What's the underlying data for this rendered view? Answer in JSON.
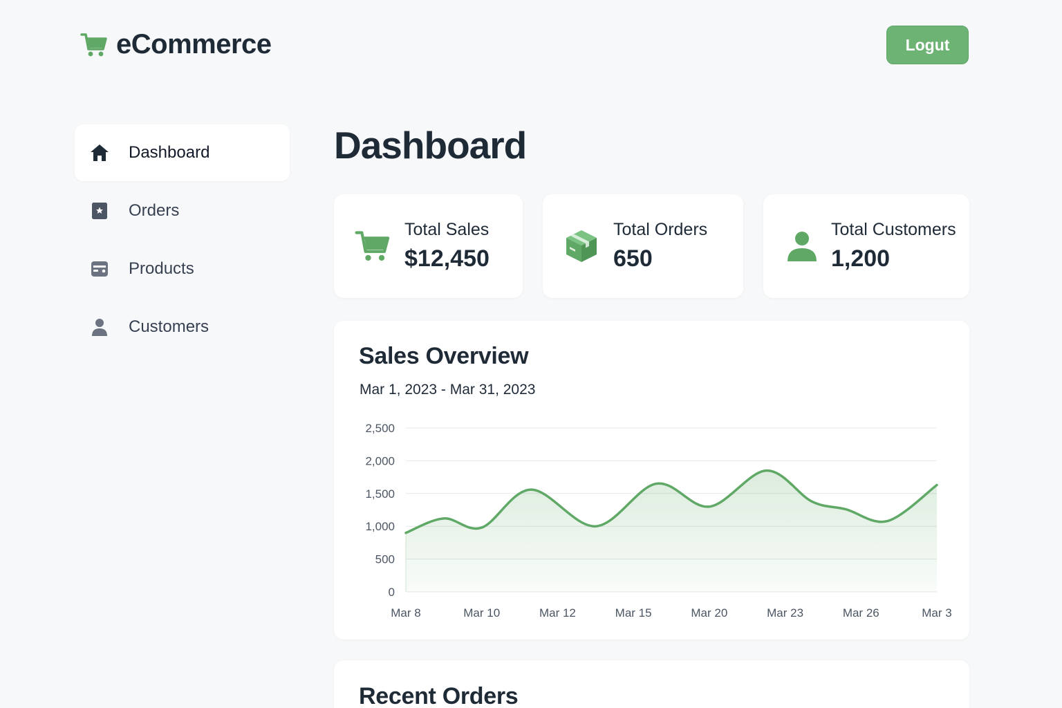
{
  "header": {
    "brand_name": "eCommerce",
    "logout_label": "Logut"
  },
  "sidebar": {
    "items": [
      {
        "label": "Dashboard",
        "icon": "home-icon",
        "active": true
      },
      {
        "label": "Orders",
        "icon": "orders-icon",
        "active": false
      },
      {
        "label": "Products",
        "icon": "products-icon",
        "active": false
      },
      {
        "label": "Customers",
        "icon": "user-icon",
        "active": false
      }
    ]
  },
  "main": {
    "title": "Dashboard",
    "stats": [
      {
        "label": "Total Sales",
        "value": "$12,450",
        "icon": "cart-icon"
      },
      {
        "label": "Total Orders",
        "value": "650",
        "icon": "box-icon"
      },
      {
        "label": "Total Customers",
        "value": "1,200",
        "icon": "user-icon"
      }
    ],
    "sales_overview": {
      "title": "Sales Overview",
      "date_range": "Mar 1, 2023 - Mar 31, 2023"
    },
    "recent_orders": {
      "title": "Recent Orders"
    }
  },
  "colors": {
    "accent": "#6db374",
    "line": "#5fa865",
    "text": "#1f2a37",
    "background": "#f7f8f9"
  },
  "chart_data": {
    "type": "area",
    "title": "Sales Overview",
    "subtitle": "Mar 1, 2023 - Mar 31, 2023",
    "xlabel": "",
    "ylabel": "",
    "ylim": [
      0,
      2500
    ],
    "y_ticks": [
      "0",
      "500",
      "1,000",
      "1,500",
      "2,000",
      "2,500"
    ],
    "x_ticks": [
      "Mar 8",
      "Mar 10",
      "Mar 12",
      "Mar 15",
      "Mar 20",
      "Mar 23",
      "Mar 26",
      "Mar 3"
    ],
    "grid": true,
    "series": [
      {
        "points": [
          {
            "x": 0.0,
            "y": 900
          },
          {
            "x": 0.5,
            "y": 1120
          },
          {
            "x": 1.0,
            "y": 980
          },
          {
            "x": 1.65,
            "y": 1560
          },
          {
            "x": 2.5,
            "y": 1000
          },
          {
            "x": 3.3,
            "y": 1650
          },
          {
            "x": 4.0,
            "y": 1300
          },
          {
            "x": 4.75,
            "y": 1850
          },
          {
            "x": 5.35,
            "y": 1380
          },
          {
            "x": 5.8,
            "y": 1260
          },
          {
            "x": 6.35,
            "y": 1080
          },
          {
            "x": 7.0,
            "y": 1630
          }
        ]
      }
    ]
  }
}
